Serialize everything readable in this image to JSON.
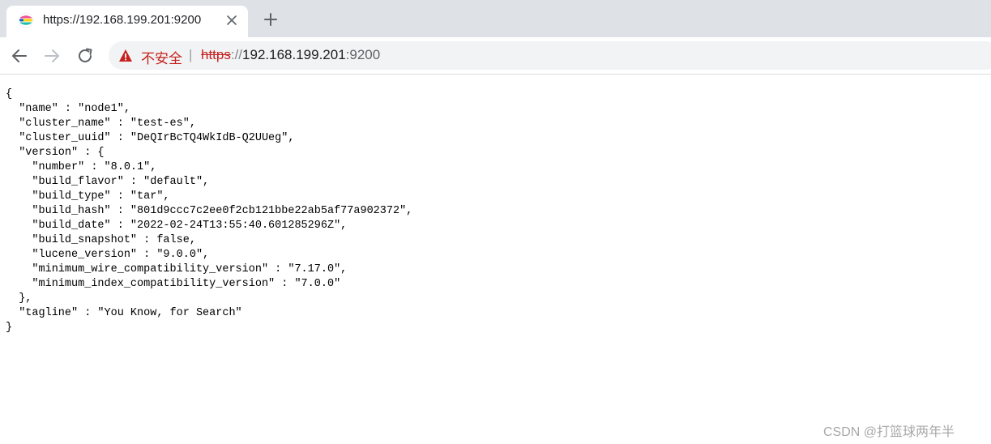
{
  "tab": {
    "title": "https://192.168.199.201:9200",
    "favicon_icon": "elastic-logo-icon",
    "close_icon": "close-icon"
  },
  "toolbar": {
    "back_icon": "back-arrow-icon",
    "forward_icon": "forward-arrow-icon",
    "reload_icon": "reload-icon",
    "new_tab_icon": "plus-icon"
  },
  "address_bar": {
    "security_icon": "warning-triangle-icon",
    "security_label": "不安全",
    "separator": "|",
    "scheme": "https",
    "scheme_sep": "://",
    "host": "192.168.199.201",
    "port": ":9200"
  },
  "content": {
    "json_text": "{\n  \"name\" : \"node1\",\n  \"cluster_name\" : \"test-es\",\n  \"cluster_uuid\" : \"DeQIrBcTQ4WkIdB-Q2UUeg\",\n  \"version\" : {\n    \"number\" : \"8.0.1\",\n    \"build_flavor\" : \"default\",\n    \"build_type\" : \"tar\",\n    \"build_hash\" : \"801d9ccc7c2ee0f2cb121bbe22ab5af77a902372\",\n    \"build_date\" : \"2022-02-24T13:55:40.601285296Z\",\n    \"build_snapshot\" : false,\n    \"lucene_version\" : \"9.0.0\",\n    \"minimum_wire_compatibility_version\" : \"7.17.0\",\n    \"minimum_index_compatibility_version\" : \"7.0.0\"\n  },\n  \"tagline\" : \"You Know, for Search\"\n}"
  },
  "watermark": "CSDN @打篮球两年半",
  "colors": {
    "tabstrip_bg": "#dee1e6",
    "omnibox_bg": "#f1f3f4",
    "insecure_red": "#c5221f"
  }
}
